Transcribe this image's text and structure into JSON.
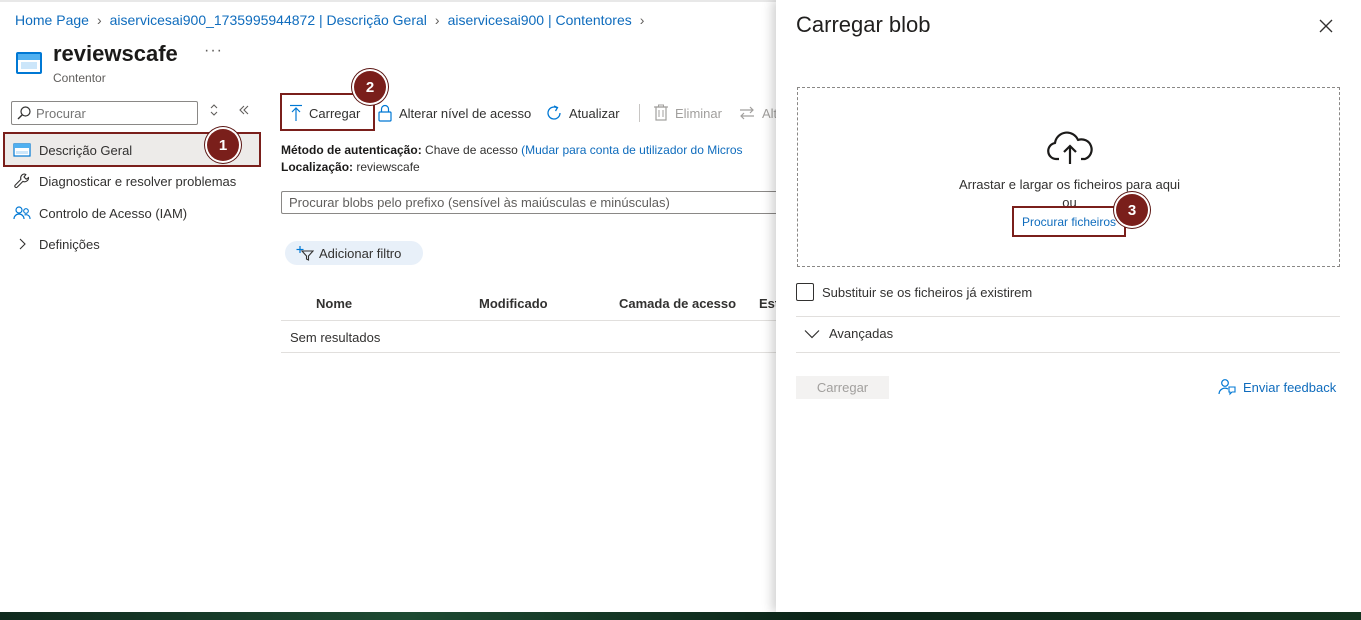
{
  "breadcrumb": {
    "items": [
      "Home Page",
      "aiservicesai900_1735995944872 | Descrição Geral",
      "aiservicesai900 | Contentores"
    ]
  },
  "header": {
    "title": "reviewscafe",
    "subtitle": "Contentor",
    "more": "···"
  },
  "sidebar": {
    "search_placeholder": "Procurar",
    "items": [
      {
        "label": "Descrição Geral",
        "icon": "container-icon",
        "active": true
      },
      {
        "label": "Diagnosticar e resolver problemas",
        "icon": "wrench-icon"
      },
      {
        "label": "Controlo de Acesso (IAM)",
        "icon": "people-icon"
      },
      {
        "label": "Definições",
        "icon": "chevron-right-icon"
      }
    ]
  },
  "toolbar": {
    "upload": "Carregar",
    "change_tier": "Alterar nível de acesso",
    "refresh": "Atualizar",
    "delete": "Eliminar",
    "more": "Alt"
  },
  "meta": {
    "auth_label": "Método de autenticação:",
    "auth_value": "Chave de acesso",
    "auth_link": "(Mudar para conta de utilizador do Micros",
    "location_label": "Localização:",
    "location_value": "reviewscafe"
  },
  "blob_search": {
    "placeholder": "Procurar blobs pelo prefixo (sensível às maiúsculas e minúsculas)"
  },
  "filter": {
    "add_label": "Adicionar filtro"
  },
  "table": {
    "columns": [
      "Nome",
      "Modificado",
      "Camada de acesso",
      "Est"
    ],
    "empty_text": "Sem resultados"
  },
  "badges": [
    "1",
    "2",
    "3"
  ],
  "panel": {
    "title": "Carregar blob",
    "drop_text": "Arrastar e largar os ficheiros para aqui",
    "or_text": "ou",
    "browse_link": "Procurar ficheiros",
    "overwrite_label": "Substituir se os ficheiros já existirem",
    "advanced_label": "Avançadas",
    "upload_button": "Carregar",
    "feedback_link": "Enviar feedback"
  },
  "colors": {
    "link": "#0f6cbd",
    "accent": "#0078d4",
    "highlight": "#7a1f1b"
  }
}
